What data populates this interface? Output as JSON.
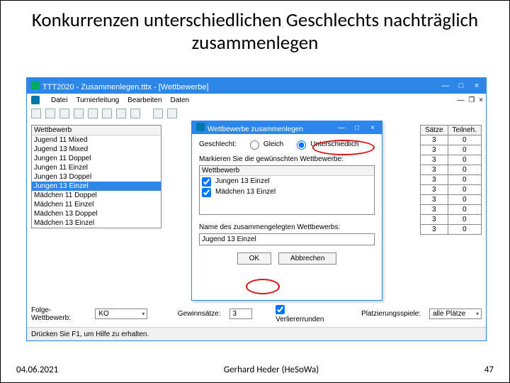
{
  "slide": {
    "title": "Konkurrenzen unterschiedlichen Geschlechts nachträglich zusammenlegen",
    "footer_date": "04.06.2021",
    "footer_author": "Gerhard Heder (HeSoWa)",
    "footer_page": "47"
  },
  "app": {
    "window_title": "TTT2020 - Zusammenlegen.tttx - [Wettbewerbe]",
    "menu": [
      "Datei",
      "Turnierleitung",
      "Bearbeiten",
      "Daten"
    ],
    "statusbar": "Drücken Sie F1, um Hilfe zu erhalten.",
    "left_header": "Wettbewerb",
    "left_list": [
      "Jugend 11 Mixed",
      "Jugend 13 Mixed",
      "Jungen 11 Doppel",
      "Jungen 11 Einzel",
      "Jungen 13 Doppel"
    ],
    "left_list_selected": "Jungen 13 Einzel",
    "left_list_after": [
      "Mädchen 11 Doppel",
      "Mädchen 11 Einzel",
      "Mädchen 13 Doppel",
      "Mädchen 13 Einzel"
    ],
    "right_headers": {
      "col1": "Sätze",
      "col2": "Teilneh."
    },
    "right_rows": [
      {
        "c1": "3",
        "c2": "0"
      },
      {
        "c1": "3",
        "c2": "0"
      },
      {
        "c1": "3",
        "c2": "0"
      },
      {
        "c1": "3",
        "c2": "0"
      },
      {
        "c1": "3",
        "c2": "0"
      },
      {
        "c1": "3",
        "c2": "0"
      },
      {
        "c1": "3",
        "c2": "0"
      },
      {
        "c1": "3",
        "c2": "0"
      },
      {
        "c1": "3",
        "c2": "0"
      },
      {
        "c1": "3",
        "c2": "0"
      }
    ],
    "bottom": {
      "label1": "Folge-Wettbewerb:",
      "select1": "KO",
      "label2": "Gewinnsätze:",
      "num": "3",
      "cb_label": "Verliererrunden",
      "cb_checked": true,
      "label3": "Platzierungsspiele:",
      "select3": "alle Plätze"
    }
  },
  "dialog": {
    "title": "Wettbewerbe zusammenlegen",
    "gender_label": "Geschlecht:",
    "radio_same": "Gleich",
    "radio_diff": "Unterschiedlich",
    "hint": "Markieren Sie die gewünschten Wettbewerbe:",
    "list_header": "Wettbewerb",
    "list_items": [
      "Jungen 13 Einzel",
      "Mädchen 13 Einzel"
    ],
    "name_label": "Name des zusammengelegten Wettbewerbs:",
    "name_value": "Jugend 13 Einzel",
    "ok": "OK",
    "cancel": "Abbrechen"
  }
}
